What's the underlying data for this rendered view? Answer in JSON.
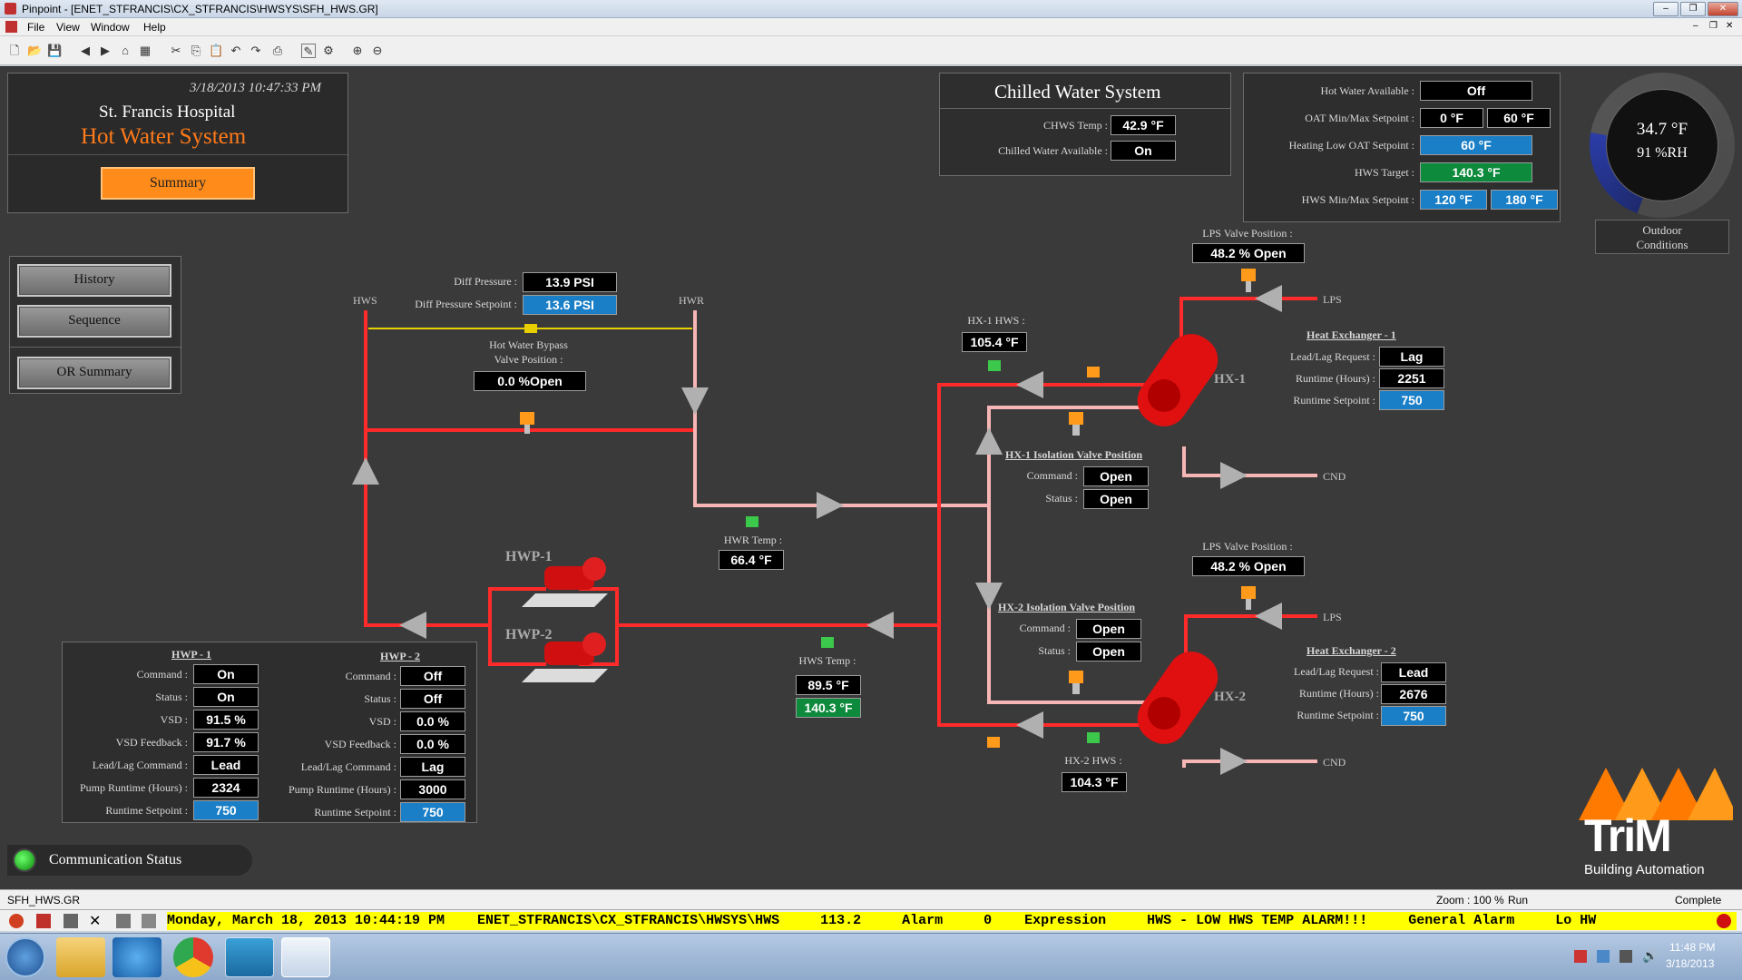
{
  "window": {
    "title": "Pinpoint - [ENET_STFRANCIS\\CX_STFRANCIS\\HWSYS\\SFH_HWS.GR]",
    "menu": [
      "File",
      "View",
      "Window",
      "Help"
    ]
  },
  "header": {
    "timestamp": "3/18/2013 10:47:33 PM",
    "hospital": "St. Francis Hospital",
    "system": "Hot Water System",
    "summary_button": "Summary"
  },
  "nav": {
    "history": "History",
    "sequence": "Sequence",
    "or_summary": "OR Summary"
  },
  "chilled_water": {
    "title": "Chilled Water System",
    "chws_temp_label": "CHWS Temp :",
    "chws_temp": "42.9 °F",
    "available_label": "Chilled Water Available :",
    "available": "On"
  },
  "hot_water_settings": {
    "available_label": "Hot Water Available :",
    "available": "Off",
    "oat_label": "OAT Min/Max Setpoint :",
    "oat_min": "0 °F",
    "oat_max": "60 °F",
    "heating_low_label": "Heating Low OAT Setpoint :",
    "heating_low": "60 °F",
    "hws_target_label": "HWS Target :",
    "hws_target": "140.3 °F",
    "hws_minmax_label": "HWS Min/Max Setpoint :",
    "hws_min": "120 °F",
    "hws_max": "180 °F"
  },
  "outdoor": {
    "temp": "34.7 °F",
    "rh": "91 %RH",
    "label_line1": "Outdoor",
    "label_line2": "Conditions"
  },
  "diff_pressure": {
    "label": "Diff Pressure :",
    "value": "13.9 PSI",
    "setpoint_label": "Diff Pressure Setpoint :",
    "setpoint": "13.6 PSI"
  },
  "bypass": {
    "label_line1": "Hot Water Bypass",
    "label_line2": "Valve Position :",
    "value": "0.0 %Open"
  },
  "pipe_labels": {
    "hws": "HWS",
    "hwr": "HWR",
    "lps1": "LPS",
    "lps2": "LPS",
    "cnd1": "CND",
    "cnd2": "CND"
  },
  "hwr_temp": {
    "label": "HWR Temp :",
    "value": "66.4 °F"
  },
  "hws_temp": {
    "label": "HWS Temp :",
    "value": "89.5 °F",
    "target": "140.3 °F"
  },
  "hx1_hws": {
    "label": "HX-1 HWS :",
    "value": "105.4 °F"
  },
  "hx2_hws": {
    "label": "HX-2 HWS :",
    "value": "104.3 °F"
  },
  "lps_valve_1": {
    "label": "LPS Valve Position :",
    "value": "48.2 % Open"
  },
  "lps_valve_2": {
    "label": "LPS Valve Position :",
    "value": "48.2 % Open"
  },
  "hx1_iso": {
    "title": "HX-1 Isolation Valve Position",
    "command_label": "Command :",
    "command": "Open",
    "status_label": "Status :",
    "status": "Open"
  },
  "hx2_iso": {
    "title": "HX-2 Isolation Valve Position",
    "command_label": "Command :",
    "command": "Open",
    "status_label": "Status :",
    "status": "Open"
  },
  "heat_exchanger_1": {
    "title": "Heat Exchanger - 1",
    "name": "HX-1",
    "leadlag_label": "Lead/Lag Request :",
    "leadlag": "Lag",
    "runtime_label": "Runtime (Hours) :",
    "runtime": "2251",
    "runtime_sp_label": "Runtime Setpoint :",
    "runtime_sp": "750"
  },
  "heat_exchanger_2": {
    "title": "Heat Exchanger - 2",
    "name": "HX-2",
    "leadlag_label": "Lead/Lag Request :",
    "leadlag": "Lead",
    "runtime_label": "Runtime (Hours) :",
    "runtime": "2676",
    "runtime_sp_label": "Runtime Setpoint :",
    "runtime_sp": "750"
  },
  "pumps": {
    "hwp1_name": "HWP-1",
    "hwp2_name": "HWP-2",
    "hwp1": {
      "title": "HWP - 1",
      "command_label": "Command :",
      "command": "On",
      "status_label": "Status :",
      "status": "On",
      "vsd_label": "VSD :",
      "vsd": "91.5 %",
      "vsd_fb_label": "VSD Feedback :",
      "vsd_fb": "91.7 %",
      "leadlag_label": "Lead/Lag Command :",
      "leadlag": "Lead",
      "runtime_label": "Pump Runtime (Hours) :",
      "runtime": "2324",
      "runtime_sp_label": "Runtime Setpoint :",
      "runtime_sp": "750"
    },
    "hwp2": {
      "title": "HWP - 2",
      "command_label": "Command :",
      "command": "Off",
      "status_label": "Status :",
      "status": "Off",
      "vsd_label": "VSD :",
      "vsd": "0.0 %",
      "vsd_fb_label": "VSD Feedback :",
      "vsd_fb": "0.0 %",
      "leadlag_label": "Lead/Lag Command :",
      "leadlag": "Lag",
      "runtime_label": "Pump Runtime (Hours) :",
      "runtime": "3000",
      "runtime_sp_label": "Runtime Setpoint :",
      "runtime_sp": "750"
    }
  },
  "comm_status": "Communication Status",
  "logo": {
    "brand": "TriM",
    "tagline": "Building Automation"
  },
  "status_bar": {
    "file": "SFH_HWS.GR",
    "zoom": "Zoom : 100 %",
    "mode": "Run",
    "state": "Complete"
  },
  "alarm": {
    "text": "Monday, March 18, 2013 10:44:19 PM    ENET_STFRANCIS\\CX_STFRANCIS\\HWSYS\\HWS     113.2     Alarm     0    Expression     HWS - LOW HWS TEMP ALARM!!!     General Alarm     Lo HW"
  },
  "taskbar": {
    "time": "11:48 PM",
    "date": "3/18/2013"
  },
  "colors": {
    "pipe_red": "#ff2a2a",
    "pipe_pink": "#f7b6b6",
    "valve_orange": "#ff9a1a",
    "sensor_green": "#3cc84a",
    "setpoint_blue": "#1a7fc7",
    "target_green": "#0d8a3c"
  }
}
